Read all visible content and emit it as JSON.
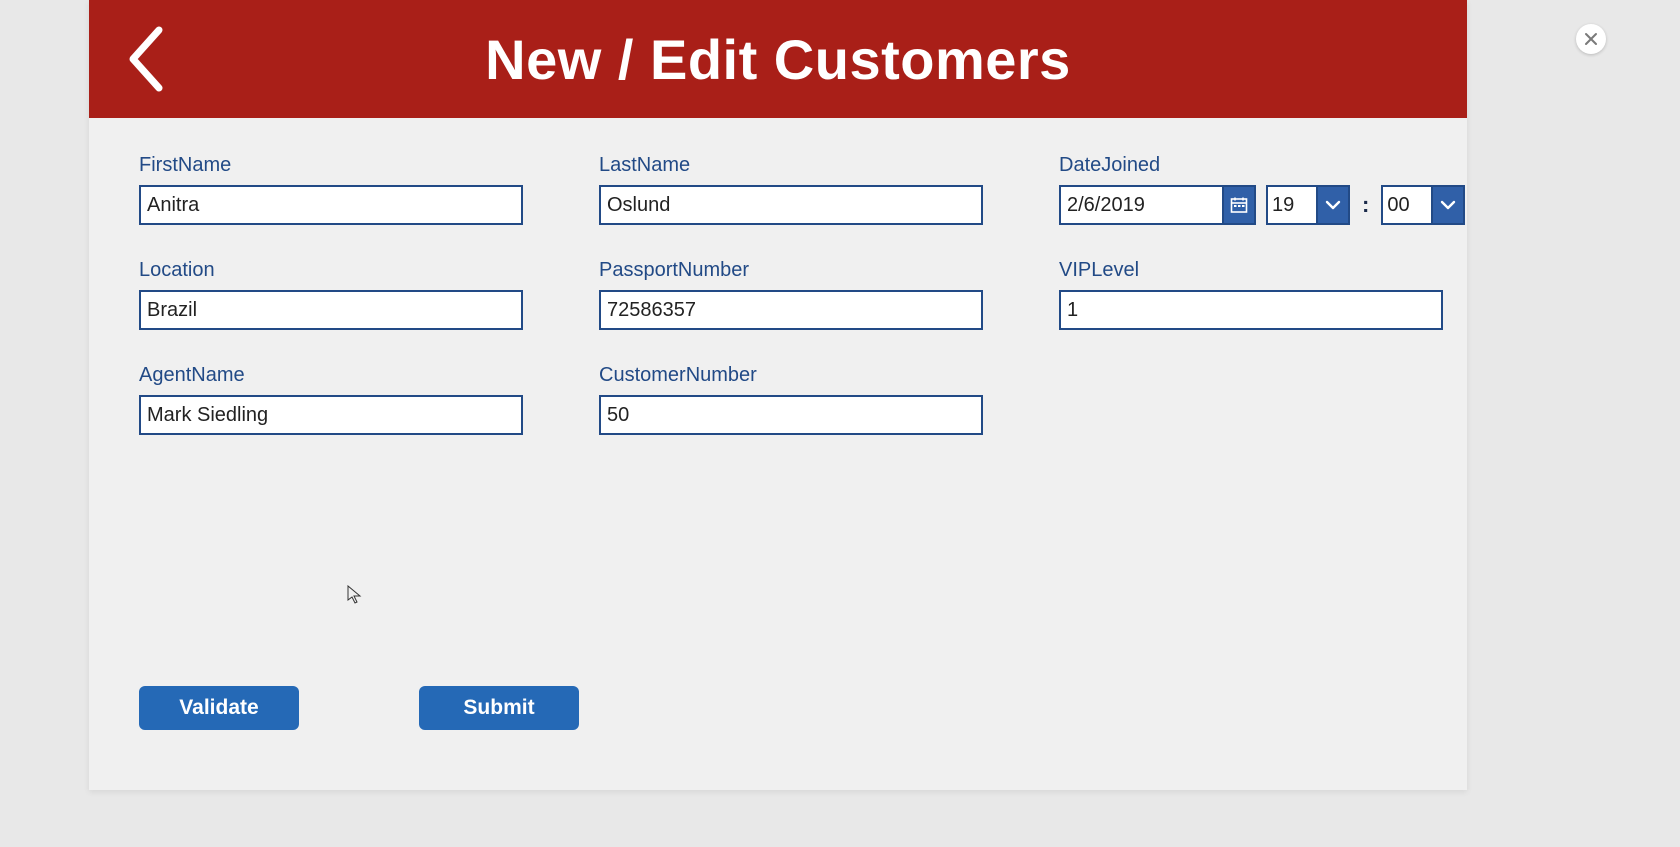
{
  "header": {
    "title": "New / Edit Customers"
  },
  "form": {
    "first_name": {
      "label": "FirstName",
      "value": "Anitra"
    },
    "last_name": {
      "label": "LastName",
      "value": "Oslund"
    },
    "date_joined": {
      "label": "DateJoined",
      "date": "2/6/2019",
      "hour": "19",
      "minute": "00",
      "separator": ":"
    },
    "location": {
      "label": "Location",
      "value": "Brazil"
    },
    "passport_number": {
      "label": "PassportNumber",
      "value": "72586357"
    },
    "vip_level": {
      "label": "VIPLevel",
      "value": "1"
    },
    "agent_name": {
      "label": "AgentName",
      "value": "Mark Siedling"
    },
    "customer_number": {
      "label": "CustomerNumber",
      "value": "50"
    }
  },
  "actions": {
    "validate": "Validate",
    "submit": "Submit"
  }
}
